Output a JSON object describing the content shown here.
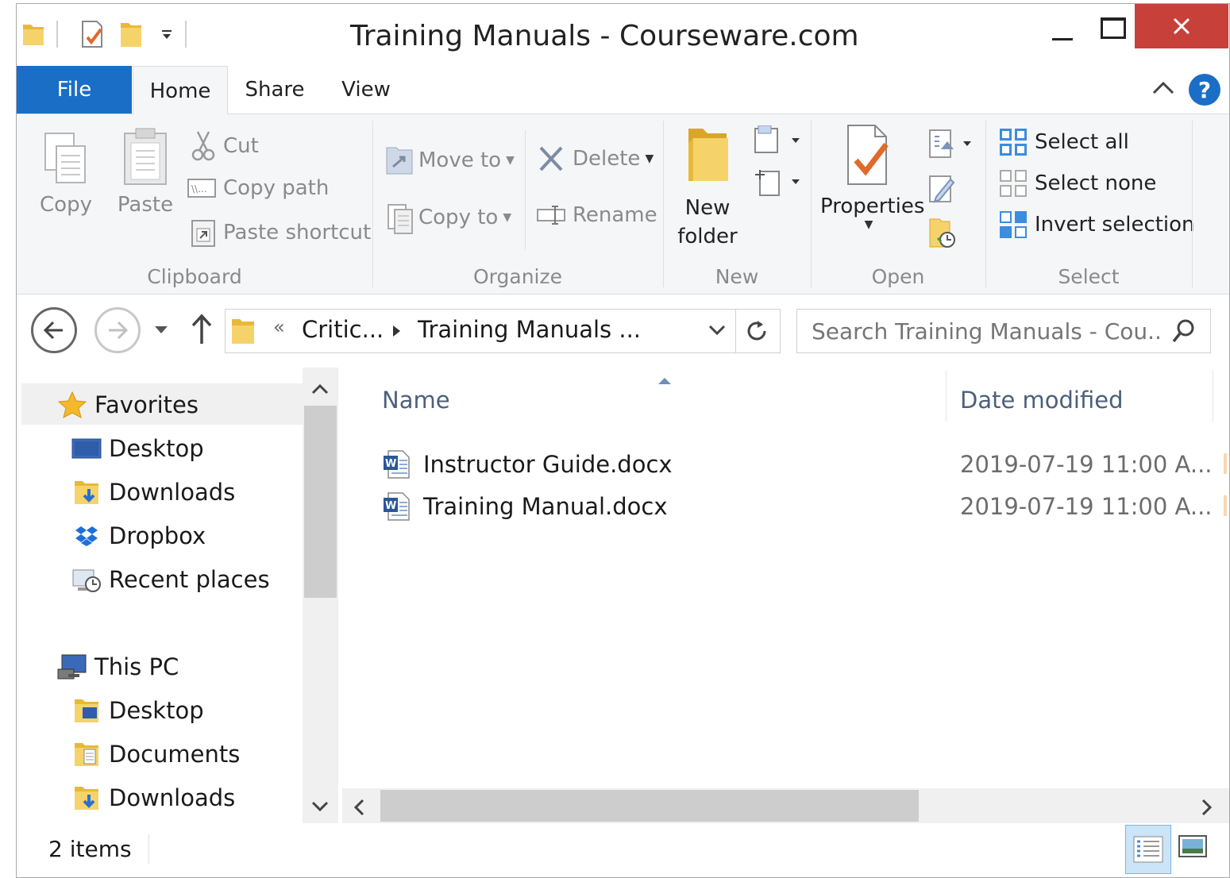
{
  "window": {
    "title": "Training Manuals - Courseware.com"
  },
  "ribbon": {
    "tabs": {
      "file": "File",
      "home": "Home",
      "share": "Share",
      "view": "View"
    },
    "clipboard": {
      "label": "Clipboard",
      "copy": "Copy",
      "paste": "Paste",
      "cut": "Cut",
      "copy_path": "Copy path",
      "paste_shortcut": "Paste shortcut"
    },
    "organize": {
      "label": "Organize",
      "move_to": "Move to",
      "copy_to": "Copy to",
      "delete": "Delete",
      "rename": "Rename"
    },
    "new": {
      "label": "New",
      "new_folder_line1": "New",
      "new_folder_line2": "folder"
    },
    "open": {
      "label": "Open",
      "properties": "Properties"
    },
    "select": {
      "label": "Select",
      "select_all": "Select all",
      "select_none": "Select none",
      "invert_selection": "Invert selection"
    }
  },
  "address": {
    "overflow": "«",
    "crumbs": [
      "Critic...",
      "Training Manuals ..."
    ],
    "search_placeholder": "Search Training Manuals - Cou..."
  },
  "nav": {
    "favorites": {
      "label": "Favorites",
      "items": [
        "Desktop",
        "Downloads",
        "Dropbox",
        "Recent places"
      ]
    },
    "this_pc": {
      "label": "This PC",
      "items": [
        "Desktop",
        "Documents",
        "Downloads"
      ]
    }
  },
  "files": {
    "columns": {
      "name": "Name",
      "date": "Date modified"
    },
    "rows": [
      {
        "name": "Instructor Guide.docx",
        "date": "2019-07-19 11:00 A..."
      },
      {
        "name": "Training Manual.docx",
        "date": "2019-07-19 11:00 A..."
      }
    ]
  },
  "status": {
    "count": "2 items"
  },
  "colors": {
    "file_tab": "#1a6ec5",
    "close": "#c8403a",
    "folder": "#f3c74d"
  }
}
